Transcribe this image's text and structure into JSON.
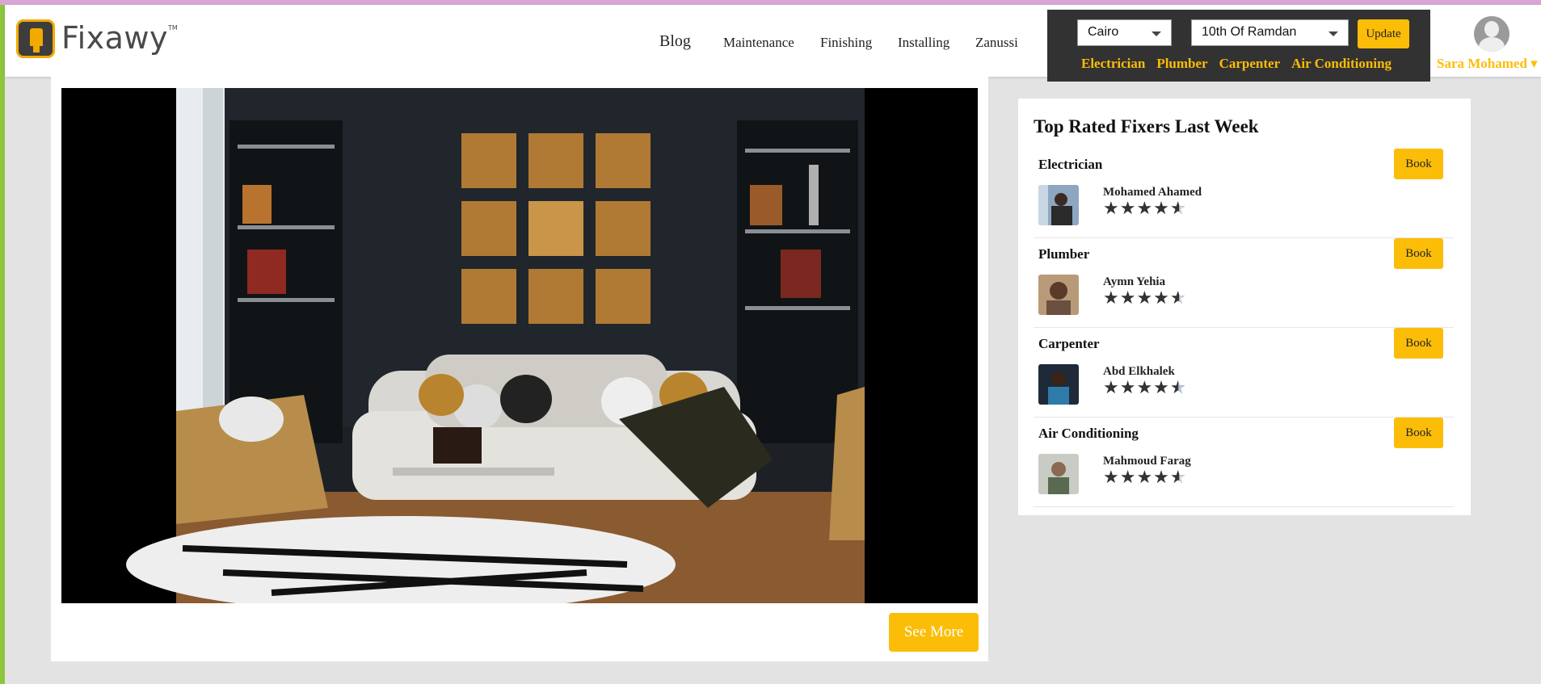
{
  "brand": {
    "name": "Fixawy",
    "tm": "TM"
  },
  "nav": {
    "blog": "Blog",
    "items": [
      "Maintenance",
      "Finishing",
      "Installing",
      "Zanussi"
    ]
  },
  "location": {
    "city": "Cairo",
    "area": "10th Of Ramdan",
    "update_label": "Update",
    "categories": [
      "Electrician",
      "Plumber",
      "Carpenter",
      "Air Conditioning"
    ]
  },
  "user": {
    "name": "Sara Mohamed"
  },
  "main": {
    "see_more_label": "See More"
  },
  "sidebar": {
    "title": "Top Rated Fixers Last Week",
    "book_label": "Book",
    "fixers": [
      {
        "category": "Electrician",
        "name": "Mohamed Ahamed",
        "rating": 4.5
      },
      {
        "category": "Plumber",
        "name": "Aymn Yehia",
        "rating": 4.5
      },
      {
        "category": "Carpenter",
        "name": "Abd Elkhalek",
        "rating": 4.5
      },
      {
        "category": "Air Conditioning",
        "name": "Mahmoud Farag",
        "rating": 4.5
      }
    ]
  },
  "colors": {
    "accent": "#fbbd08",
    "dark_panel": "#323232",
    "background": "#e3e3e3"
  }
}
